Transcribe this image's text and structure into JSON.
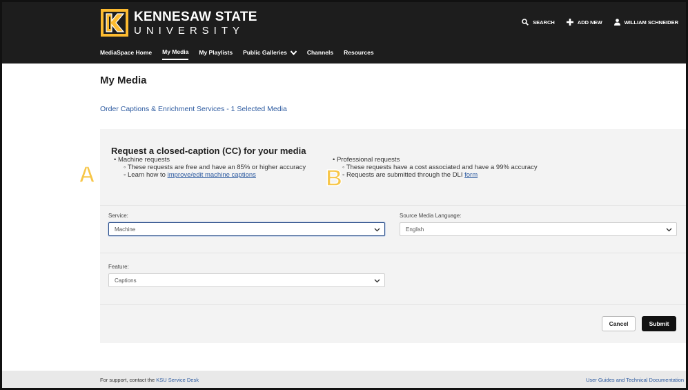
{
  "header": {
    "logo": {
      "line1": "KENNESAW STATE",
      "line2": "UNIVERSITY",
      "logo_icon": "ksu-k-logo"
    },
    "utility": {
      "search": "SEARCH",
      "add_new": "ADD NEW",
      "user": "WILLIAM SCHNEIDER"
    },
    "nav": [
      {
        "label": "MediaSpace Home",
        "active": false
      },
      {
        "label": "My Media",
        "active": true
      },
      {
        "label": "My Playlists",
        "active": false
      },
      {
        "label": "Public Galleries",
        "active": false,
        "dropdown": true
      },
      {
        "label": "Channels",
        "active": false
      },
      {
        "label": "Resources",
        "active": false
      }
    ]
  },
  "page": {
    "title": "My Media",
    "subtitle": "Order Captions & Enrichment Services - 1 Selected Media"
  },
  "request": {
    "heading": "Request a closed-caption (CC) for your media",
    "machine": {
      "title": "Machine requests",
      "item1": "These requests are free and have an 85% or higher accuracy",
      "item2_prefix": "Learn how to ",
      "item2_link": "improve/edit machine captions"
    },
    "professional": {
      "title": "Professional requests",
      "item1": "These requests have a cost associated and have a 99% accuracy",
      "item2_prefix": "Requests are submitted through the DLI ",
      "item2_link": "form"
    },
    "badges": {
      "a": "A",
      "b": "B"
    }
  },
  "form": {
    "service_label": "Service:",
    "service_value": "Machine",
    "language_label": "Source Media Language:",
    "language_value": "English",
    "feature_label": "Feature:",
    "feature_value": "Captions",
    "cancel": "Cancel",
    "submit": "Submit"
  },
  "footer": {
    "support_prefix": "For support, contact the ",
    "support_link": "KSU Service Desk",
    "right_link": "User Guides and Technical Documentation"
  },
  "colors": {
    "header_bg": "#1d1d1d",
    "link": "#2c5aa0",
    "badge_yellow": "#f7c648",
    "ksu_gold": "#fdbb30"
  }
}
